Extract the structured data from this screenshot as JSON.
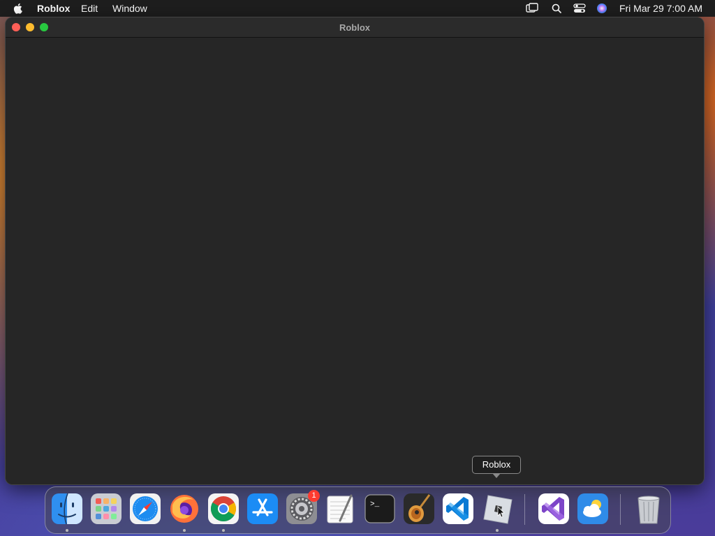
{
  "menubar": {
    "apple": "apple-icon",
    "app_name": "Roblox",
    "items": [
      "Edit",
      "Window"
    ],
    "status_icons": [
      "screen-mirroring-icon",
      "search-icon",
      "control-center-icon",
      "siri-icon"
    ],
    "clock": "Fri Mar 29  7:00 AM"
  },
  "window": {
    "title": "Roblox"
  },
  "tooltip": {
    "label": "Roblox"
  },
  "dock": {
    "items": [
      {
        "name": "Finder",
        "icon": "finder-icon"
      },
      {
        "name": "Launchpad",
        "icon": "launchpad-icon"
      },
      {
        "name": "Safari",
        "icon": "safari-icon"
      },
      {
        "name": "Firefox",
        "icon": "firefox-icon"
      },
      {
        "name": "Chrome",
        "icon": "chrome-icon"
      },
      {
        "name": "App Store",
        "icon": "app-store-icon"
      },
      {
        "name": "System Settings",
        "icon": "system-settings-icon",
        "badge": "1"
      },
      {
        "name": "TextEdit",
        "icon": "textedit-icon"
      },
      {
        "name": "Terminal",
        "icon": "terminal-icon",
        "prompt": ">_"
      },
      {
        "name": "GarageBand",
        "icon": "garageband-icon"
      },
      {
        "name": "Visual Studio Code",
        "icon": "vscode-icon"
      },
      {
        "name": "Roblox",
        "icon": "roblox-icon"
      },
      {
        "name": "Visual Studio",
        "icon": "visual-studio-icon"
      },
      {
        "name": "Weather",
        "icon": "weather-icon"
      },
      {
        "name": "Trash",
        "icon": "trash-icon"
      }
    ]
  }
}
